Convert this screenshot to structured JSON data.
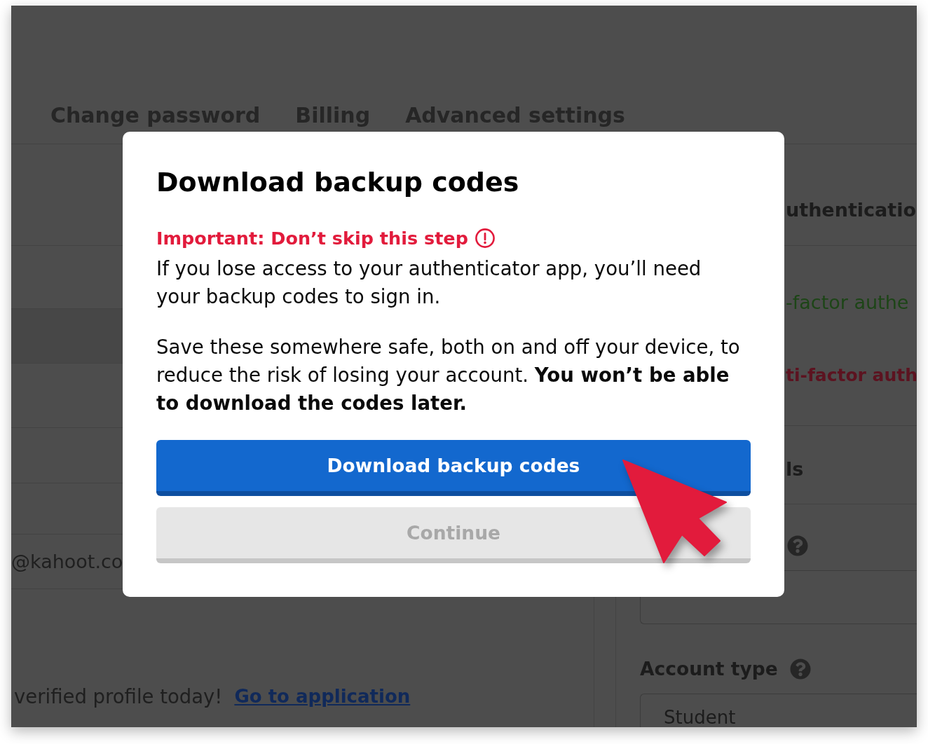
{
  "background_page": {
    "tabs": [
      {
        "label": "Change password",
        "selected": false
      },
      {
        "label": "Billing",
        "selected": false
      },
      {
        "label": "Advanced settings",
        "selected": false
      }
    ],
    "left_panel": {
      "email_fragment": "@kahoot.co",
      "notice": {
        "text": "verified profile today!",
        "link": "Go to application"
      }
    },
    "right_panel": {
      "heading_fragment": "uthenticatio",
      "status_lines": [
        {
          "kind": "enabled",
          "text": "-factor authe"
        },
        {
          "kind": "disabled",
          "text": "ti-factor auth"
        }
      ],
      "section_fragment": "ls",
      "account_type": {
        "label": "Account type",
        "value": "Student"
      }
    }
  },
  "dialog": {
    "title": "Download backup codes",
    "warning": "Important: Don’t skip this step",
    "paragraphs": [
      "If you lose access to your authenticator app, you’ll need your backup codes to sign in.",
      "Save these somewhere safe, both on and off your device, to reduce the risk of losing your account. **You won’t be able to download the codes later.**"
    ],
    "buttons": [
      {
        "label": "Download backup codes",
        "kind": "primary",
        "disabled": false
      },
      {
        "label": "Continue",
        "kind": "secondary",
        "disabled": true
      }
    ]
  }
}
